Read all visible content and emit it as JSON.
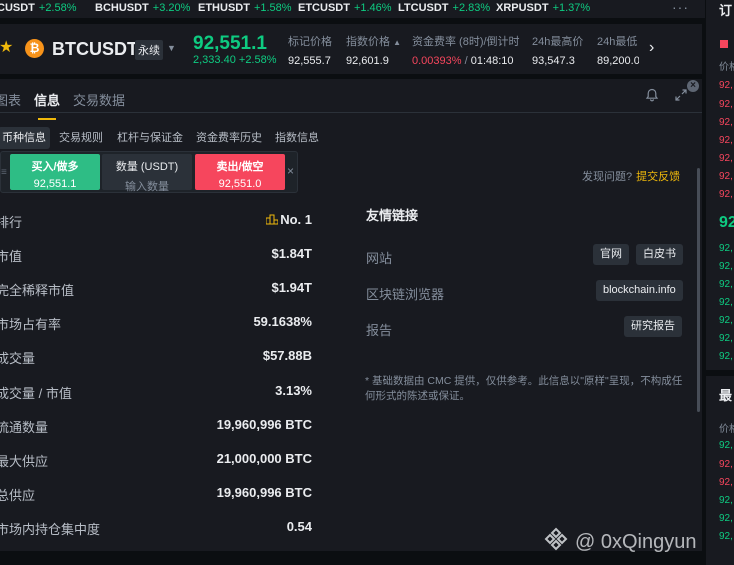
{
  "tickers": [
    {
      "symbol": "CUSDT",
      "change": "+2.58%"
    },
    {
      "symbol": "BCHUSDT",
      "change": "+3.20%"
    },
    {
      "symbol": "ETHUSDT",
      "change": "+1.58%"
    },
    {
      "symbol": "ETCUSDT",
      "change": "+1.46%"
    },
    {
      "symbol": "LTCUSDT",
      "change": "+2.83%"
    },
    {
      "symbol": "XRPUSDT",
      "change": "+1.37%"
    }
  ],
  "header": {
    "coin_letter": "₿",
    "symbol": "BTCUSDT",
    "contract_type": "永续",
    "last_price": "92,551.1",
    "change_abs": "2,333.40",
    "change_pct": "+2.58%",
    "stats": [
      {
        "label": "标记价格",
        "value": "92,555.7"
      },
      {
        "label": "指数价格",
        "value": "92,601.9"
      },
      {
        "label": "资金费率 (8时)/倒计时",
        "value_red": "0.00393%",
        "value_sep": " / ",
        "value_rest": "01:48:10"
      },
      {
        "label": "24h最高价",
        "value": "93,547.3"
      },
      {
        "label": "24h最低",
        "value": "89,200.0"
      }
    ]
  },
  "main_tabs": [
    "图表",
    "信息",
    "交易数据"
  ],
  "sub_tabs": [
    "币种信息",
    "交易规则",
    "杠杆与保证金",
    "资金费率历史",
    "指数信息"
  ],
  "order_widget": {
    "buy_label": "买入/做多",
    "buy_price": "92,551.1",
    "qty_label": "数量 (USDT)",
    "qty_placeholder": "输入数量",
    "sell_label": "卖出/做空",
    "sell_price": "92,551.0"
  },
  "feedback": {
    "question": "发现问题?",
    "link": "提交反馈"
  },
  "coin_stats": [
    {
      "key": "排行",
      "value": "No. 1"
    },
    {
      "key": "市值",
      "value": "$1.84T"
    },
    {
      "key": "完全稀释市值",
      "value": "$1.94T"
    },
    {
      "key": "市场占有率",
      "value": "59.1638%"
    },
    {
      "key": "成交量",
      "value": "$57.88B"
    },
    {
      "key": "成交量 / 市值",
      "value": "3.13%"
    },
    {
      "key": "流通数量",
      "value": "19,960,996 BTC"
    },
    {
      "key": "最大供应",
      "value": "21,000,000 BTC"
    },
    {
      "key": "总供应",
      "value": "19,960,996 BTC"
    },
    {
      "key": "市场内持仓集中度",
      "value": "0.54"
    }
  ],
  "links": {
    "title": "友情链接",
    "website_label": "网站",
    "website_btn1": "官网",
    "website_btn2": "白皮书",
    "explorer_label": "区块链浏览器",
    "explorer_btn": "blockchain.info",
    "report_label": "报告",
    "report_btn": "研究报告",
    "disclaimer": "* 基础数据由 CMC 提供，仅供参考。此信息以\"原样\"呈现，不构成任何形式的陈述或保证。"
  },
  "right_column": {
    "top_title": "订",
    "top_price_label": "价格",
    "top_prices": [
      "92,",
      "92,",
      "92,",
      "92,",
      "92,",
      "92,",
      "92,"
    ],
    "mid_price": "92",
    "bottom_prices": [
      "92,",
      "92,",
      "92,",
      "92,",
      "92,",
      "92,",
      "92,"
    ],
    "lower_title": "最",
    "lower_price_label": "价格",
    "lower_prices": [
      "92,",
      "92,",
      "92,",
      "92,",
      "92,",
      "92,"
    ]
  },
  "watermark": "@ 0xQingyun",
  "colors": {
    "up": "#0ecb81",
    "down": "#f6465d",
    "accent": "#f0b90b",
    "panel": "#181a20"
  }
}
